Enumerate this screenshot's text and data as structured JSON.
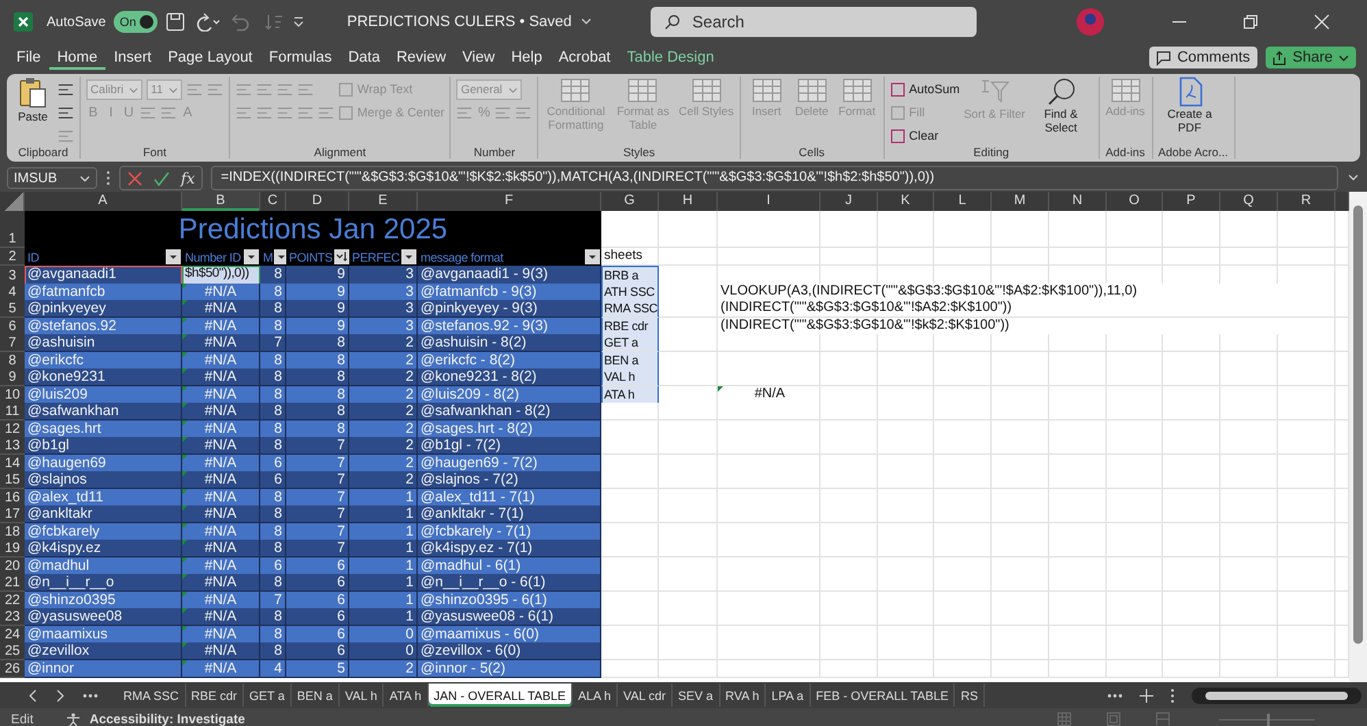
{
  "titlebar": {
    "autosave": {
      "label": "AutoSave",
      "on": true,
      "state": "On"
    },
    "title": "PREDICTIONS CULERS • Saved",
    "search": {
      "placeholder": "Search"
    }
  },
  "menu": [
    {
      "label": "File",
      "selected": false,
      "contextual": false
    },
    {
      "label": "Home",
      "selected": true,
      "contextual": false
    },
    {
      "label": "Insert",
      "selected": false,
      "contextual": false
    },
    {
      "label": "Page Layout",
      "selected": false,
      "contextual": false
    },
    {
      "label": "Formulas",
      "selected": false,
      "contextual": false
    },
    {
      "label": "Data",
      "selected": false,
      "contextual": false
    },
    {
      "label": "Review",
      "selected": false,
      "contextual": false
    },
    {
      "label": "View",
      "selected": false,
      "contextual": false
    },
    {
      "label": "Help",
      "selected": false,
      "contextual": false
    },
    {
      "label": "Acrobat",
      "selected": false,
      "contextual": false
    },
    {
      "label": "Table Design",
      "selected": false,
      "contextual": true
    }
  ],
  "comments": "Comments",
  "share": "Share",
  "ribbon": {
    "groups": [
      {
        "label": "Clipboard",
        "parts": [
          {
            "kind": "large",
            "label": "Paste",
            "disabled": false
          },
          {
            "kind": "stack",
            "rows": [
              {
                "items": [
                  {
                    "kind": "icon",
                    "disabled": false
                  }
                ]
              },
              {
                "items": [
                  {
                    "kind": "icon",
                    "disabled": false
                  }
                ]
              },
              {
                "items": [
                  {
                    "kind": "icon",
                    "disabled": true
                  }
                ]
              }
            ]
          }
        ]
      },
      {
        "label": "Font",
        "parts": [
          {
            "kind": "stack",
            "rows": [
              {
                "items": [
                  {
                    "kind": "field",
                    "value": "Calibri",
                    "disabled": true
                  },
                  {
                    "kind": "field",
                    "value": "11",
                    "disabled": true
                  },
                  {
                    "kind": "icon",
                    "disabled": true
                  },
                  {
                    "kind": "icon",
                    "disabled": true
                  }
                ]
              },
              {
                "items": [
                  {
                    "kind": "glyph",
                    "label": "B",
                    "disabled": true
                  },
                  {
                    "kind": "glyph",
                    "label": "I",
                    "disabled": true
                  },
                  {
                    "kind": "glyph",
                    "label": "U",
                    "disabled": true
                  },
                  {
                    "kind": "icon",
                    "disabled": true
                  },
                  {
                    "kind": "icon",
                    "disabled": true
                  },
                  {
                    "kind": "glyph",
                    "label": "A",
                    "disabled": true
                  }
                ]
              }
            ]
          }
        ]
      },
      {
        "label": "Alignment",
        "parts": [
          {
            "kind": "stack",
            "rows": [
              {
                "items": [
                  {
                    "kind": "icon",
                    "disabled": true
                  },
                  {
                    "kind": "icon",
                    "disabled": true
                  },
                  {
                    "kind": "icon",
                    "disabled": true
                  },
                  {
                    "kind": "icon",
                    "disabled": true
                  }
                ]
              },
              {
                "items": [
                  {
                    "kind": "icon",
                    "disabled": true
                  },
                  {
                    "kind": "icon",
                    "disabled": true
                  },
                  {
                    "kind": "icon",
                    "disabled": true
                  },
                  {
                    "kind": "icon",
                    "disabled": true
                  },
                  {
                    "kind": "icon",
                    "disabled": true
                  }
                ]
              }
            ]
          },
          {
            "kind": "stack",
            "rows": [
              {
                "items": [
                  {
                    "kind": "small",
                    "label": "Wrap Text",
                    "disabled": true
                  }
                ]
              },
              {
                "items": [
                  {
                    "kind": "small",
                    "label": "Merge & Center",
                    "disabled": true
                  }
                ]
              }
            ]
          }
        ]
      },
      {
        "label": "Number",
        "parts": [
          {
            "kind": "stack",
            "rows": [
              {
                "items": [
                  {
                    "kind": "field",
                    "value": "General",
                    "disabled": true
                  }
                ]
              },
              {
                "items": [
                  {
                    "kind": "icon",
                    "disabled": true
                  },
                  {
                    "kind": "glyph",
                    "label": "%",
                    "disabled": true
                  },
                  {
                    "kind": "icon",
                    "disabled": true
                  },
                  {
                    "kind": "icon",
                    "disabled": true
                  }
                ]
              }
            ]
          }
        ]
      },
      {
        "label": "Styles",
        "parts": [
          {
            "kind": "large",
            "label": "Conditional Formatting",
            "disabled": true
          },
          {
            "kind": "large",
            "label": "Format as Table",
            "disabled": true
          },
          {
            "kind": "large",
            "label": "Cell Styles",
            "disabled": true
          }
        ]
      },
      {
        "label": "Cells",
        "parts": [
          {
            "kind": "large",
            "label": "Insert",
            "disabled": true
          },
          {
            "kind": "large",
            "label": "Delete",
            "disabled": true
          },
          {
            "kind": "large",
            "label": "Format",
            "disabled": true
          }
        ]
      },
      {
        "label": "Editing",
        "parts": [
          {
            "kind": "stack",
            "rows": [
              {
                "items": [
                  {
                    "kind": "small",
                    "label": "AutoSum",
                    "disabled": false
                  }
                ]
              },
              {
                "items": [
                  {
                    "kind": "small",
                    "label": "Fill",
                    "disabled": true
                  }
                ]
              },
              {
                "items": [
                  {
                    "kind": "small",
                    "label": "Clear",
                    "disabled": false
                  }
                ]
              }
            ]
          },
          {
            "kind": "large",
            "label": "Sort & Filter",
            "disabled": true
          },
          {
            "kind": "large",
            "label": "Find & Select",
            "disabled": false
          }
        ]
      },
      {
        "label": "Add-ins",
        "parts": [
          {
            "kind": "large",
            "label": "Add-ins",
            "disabled": true
          }
        ]
      },
      {
        "label": "Adobe Acro...",
        "parts": [
          {
            "kind": "large",
            "label": "Create a PDF",
            "disabled": false
          }
        ]
      }
    ]
  },
  "formula_bar": {
    "name_box": "IMSUB",
    "fx": "fx",
    "formula": "=INDEX((INDIRECT(\"'\"&$G$3:$G$10&\"'!$K$2:$k$50\")),MATCH(A3,(INDIRECT(\"'\"&$G$3:$G$10&\"'!$h$2:$h$50\")),0))"
  },
  "sheet": {
    "columns": [
      "A",
      "B",
      "C",
      "D",
      "E",
      "F",
      "G",
      "H",
      "I",
      "J",
      "K",
      "L",
      "M",
      "N",
      "O",
      "P",
      "Q",
      "R"
    ],
    "title_row": "1",
    "header_row": "2",
    "title": "Predictions Jan 2025",
    "headers": [
      {
        "label": "ID",
        "kind": "dropdown"
      },
      {
        "label": "Number ID",
        "kind": "dropdown"
      },
      {
        "label": "M",
        "kind": "dropdown"
      },
      {
        "label": "POINTS",
        "kind": "sort"
      },
      {
        "label": "PERFEC",
        "kind": "dropdown"
      },
      {
        "label": "message format",
        "kind": "dropdown"
      }
    ],
    "sheets_header": "sheets",
    "rows": [
      {
        "row": "3",
        "id": "@avganaadi1",
        "number_id": "$h$50\")),0))",
        "m": "8",
        "points": "9",
        "perfect": "3",
        "message": "@avganaadi1 - 9(3)",
        "sheet": "BRB a",
        "flag": false,
        "referenced": true,
        "editing": true
      },
      {
        "row": "4",
        "id": "@fatmanfcb",
        "number_id": "#N/A",
        "m": "8",
        "points": "9",
        "perfect": "3",
        "message": "@fatmanfcb - 9(3)",
        "sheet": "ATH SSC",
        "flag": true,
        "referenced": false,
        "editing": false,
        "i_cell": {
          "kind": "formula",
          "text": "VLOOKUP(A3,(INDIRECT(\"'\"&$G$3:$G$10&\"'!$A$2:$K$100\")),11,0)",
          "flag": false
        }
      },
      {
        "row": "5",
        "id": "@pinkyeyey",
        "number_id": "#N/A",
        "m": "8",
        "points": "9",
        "perfect": "3",
        "message": "@pinkyeyey - 9(3)",
        "sheet": "RMA SSC",
        "flag": true,
        "referenced": false,
        "editing": false,
        "i_cell": {
          "kind": "formula",
          "text": "(INDIRECT(\"'\"&$G$3:$G$10&\"'!$A$2:$K$100\"))",
          "flag": false
        }
      },
      {
        "row": "6",
        "id": "@stefanos.92",
        "number_id": "#N/A",
        "m": "8",
        "points": "9",
        "perfect": "3",
        "message": "@stefanos.92 - 9(3)",
        "sheet": "RBE cdr",
        "flag": true,
        "referenced": false,
        "editing": false,
        "i_cell": {
          "kind": "formula",
          "text": "(INDIRECT(\"'\"&$G$3:$G$10&\"'!$k$2:$K$100\"))",
          "flag": false
        }
      },
      {
        "row": "7",
        "id": "@ashuisin",
        "number_id": "#N/A",
        "m": "7",
        "points": "8",
        "perfect": "2",
        "message": "@ashuisin - 8(2)",
        "sheet": "GET a",
        "flag": true,
        "referenced": false,
        "editing": false
      },
      {
        "row": "8",
        "id": "@erikcfc",
        "number_id": "#N/A",
        "m": "8",
        "points": "8",
        "perfect": "2",
        "message": "@erikcfc - 8(2)",
        "sheet": "BEN a",
        "flag": true,
        "referenced": false,
        "editing": false
      },
      {
        "row": "9",
        "id": "@kone9231",
        "number_id": "#N/A",
        "m": "8",
        "points": "8",
        "perfect": "2",
        "message": "@kone9231 - 8(2)",
        "sheet": "VAL h",
        "flag": true,
        "referenced": false,
        "editing": false
      },
      {
        "row": "10",
        "id": "@luis209",
        "number_id": "#N/A",
        "m": "8",
        "points": "8",
        "perfect": "2",
        "message": "@luis209 - 8(2)",
        "sheet": "ATA h",
        "flag": true,
        "referenced": false,
        "editing": false,
        "i_cell": {
          "kind": "error",
          "text": "#N/A",
          "flag": true
        }
      },
      {
        "row": "11",
        "id": "@safwankhan",
        "number_id": "#N/A",
        "m": "8",
        "points": "8",
        "perfect": "2",
        "message": "@safwankhan - 8(2)",
        "flag": true,
        "referenced": false,
        "editing": false
      },
      {
        "row": "12",
        "id": "@sages.hrt",
        "number_id": "#N/A",
        "m": "8",
        "points": "8",
        "perfect": "2",
        "message": "@sages.hrt - 8(2)",
        "flag": true,
        "referenced": false,
        "editing": false
      },
      {
        "row": "13",
        "id": "@b1gl",
        "number_id": "#N/A",
        "m": "8",
        "points": "7",
        "perfect": "2",
        "message": "@b1gl - 7(2)",
        "flag": true,
        "referenced": false,
        "editing": false
      },
      {
        "row": "14",
        "id": "@haugen69",
        "number_id": "#N/A",
        "m": "6",
        "points": "7",
        "perfect": "2",
        "message": "@haugen69 - 7(2)",
        "flag": true,
        "referenced": false,
        "editing": false
      },
      {
        "row": "15",
        "id": "@slajnos",
        "number_id": "#N/A",
        "m": "6",
        "points": "7",
        "perfect": "2",
        "message": "@slajnos - 7(2)",
        "flag": true,
        "referenced": false,
        "editing": false
      },
      {
        "row": "16",
        "id": "@alex_td11",
        "number_id": "#N/A",
        "m": "8",
        "points": "7",
        "perfect": "1",
        "message": "@alex_td11 - 7(1)",
        "flag": true,
        "referenced": false,
        "editing": false
      },
      {
        "row": "17",
        "id": "@ankltakr",
        "number_id": "#N/A",
        "m": "8",
        "points": "7",
        "perfect": "1",
        "message": "@ankltakr - 7(1)",
        "flag": true,
        "referenced": false,
        "editing": false
      },
      {
        "row": "18",
        "id": "@fcbkarely",
        "number_id": "#N/A",
        "m": "8",
        "points": "7",
        "perfect": "1",
        "message": "@fcbkarely - 7(1)",
        "flag": true,
        "referenced": false,
        "editing": false
      },
      {
        "row": "19",
        "id": "@k4ispy.ez",
        "number_id": "#N/A",
        "m": "8",
        "points": "7",
        "perfect": "1",
        "message": "@k4ispy.ez - 7(1)",
        "flag": true,
        "referenced": false,
        "editing": false
      },
      {
        "row": "20",
        "id": "@madhul",
        "number_id": "#N/A",
        "m": "6",
        "points": "6",
        "perfect": "1",
        "message": "@madhul - 6(1)",
        "flag": true,
        "referenced": false,
        "editing": false
      },
      {
        "row": "21",
        "id": "@n__i__r__o",
        "number_id": "#N/A",
        "m": "8",
        "points": "6",
        "perfect": "1",
        "message": "@n__i__r__o - 6(1)",
        "flag": true,
        "referenced": false,
        "editing": false
      },
      {
        "row": "22",
        "id": "@shinzo0395",
        "number_id": "#N/A",
        "m": "7",
        "points": "6",
        "perfect": "1",
        "message": "@shinzo0395 - 6(1)",
        "flag": true,
        "referenced": false,
        "editing": false
      },
      {
        "row": "23",
        "id": "@yasuswee08",
        "number_id": "#N/A",
        "m": "8",
        "points": "6",
        "perfect": "1",
        "message": "@yasuswee08 - 6(1)",
        "flag": true,
        "referenced": false,
        "editing": false
      },
      {
        "row": "24",
        "id": "@maamixus",
        "number_id": "#N/A",
        "m": "8",
        "points": "6",
        "perfect": "0",
        "message": "@maamixus - 6(0)",
        "flag": true,
        "referenced": false,
        "editing": false
      },
      {
        "row": "25",
        "id": "@zevillox",
        "number_id": "#N/A",
        "m": "8",
        "points": "6",
        "perfect": "0",
        "message": "@zevillox - 6(0)",
        "flag": true,
        "referenced": false,
        "editing": false
      },
      {
        "row": "26",
        "id": "@innor",
        "number_id": "#N/A",
        "m": "4",
        "points": "5",
        "perfect": "2",
        "message": "@innor - 5(2)",
        "flag": true,
        "referenced": false,
        "editing": false
      }
    ]
  },
  "sheet_tabs": [
    {
      "label": "RMA SSC",
      "selected": false
    },
    {
      "label": "RBE cdr",
      "selected": false
    },
    {
      "label": "GET a",
      "selected": false
    },
    {
      "label": "BEN a",
      "selected": false
    },
    {
      "label": "VAL h",
      "selected": false
    },
    {
      "label": "ATA h",
      "selected": false
    },
    {
      "label": "JAN - OVERALL TABLE",
      "selected": true
    },
    {
      "label": "ALA h",
      "selected": false
    },
    {
      "label": "VAL cdr",
      "selected": false
    },
    {
      "label": "SEV a",
      "selected": false
    },
    {
      "label": "RVA h",
      "selected": false
    },
    {
      "label": "LPA a",
      "selected": false
    },
    {
      "label": "FEB - OVERALL TABLE",
      "selected": false
    },
    {
      "label": "RS",
      "selected": false
    }
  ],
  "status_bar": {
    "mode": "Edit",
    "accessibility": "Accessibility: Investigate",
    "zoom_slider": {
      "level": 0.5
    }
  }
}
